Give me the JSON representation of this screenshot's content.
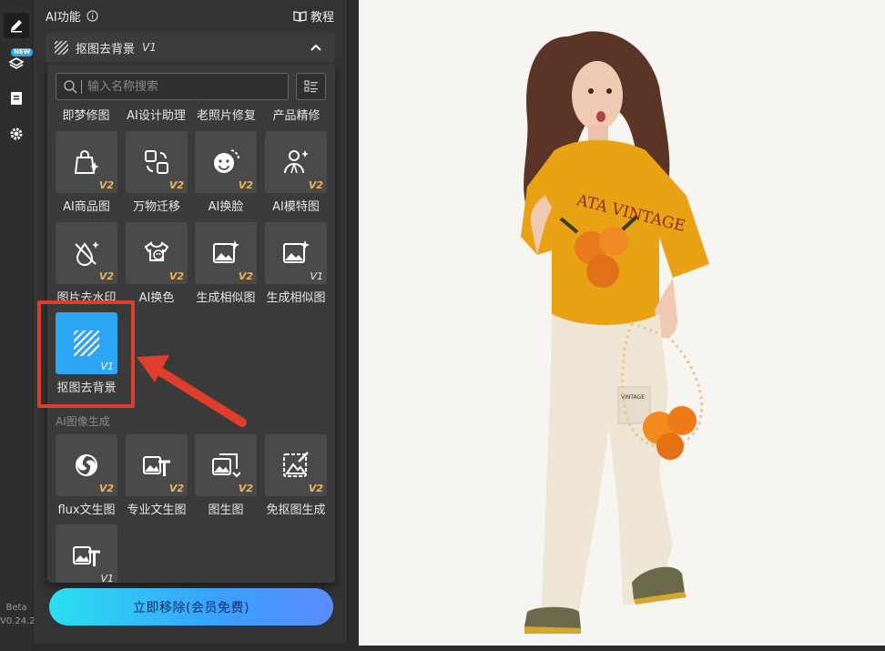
{
  "panel": {
    "title": "AI功能",
    "tutorial_label": "教程",
    "selected_feature": "抠图去背景",
    "selected_feature_version": "V1"
  },
  "rail": {
    "new_badge": "NEW",
    "beta_label": "Beta",
    "version": "V0.24.2"
  },
  "search": {
    "placeholder": "输入名称搜索"
  },
  "top_labels": [
    "即梦修图",
    "AI设计助理",
    "老照片修复",
    "产品精修"
  ],
  "tools_row1": [
    {
      "label": "AI商品图",
      "version": "V2",
      "icon": "shopping-bag-sparkle-icon"
    },
    {
      "label": "万物迁移",
      "version": "V2",
      "icon": "transfer-icon"
    },
    {
      "label": "AI换脸",
      "version": "V2",
      "icon": "face-swap-icon"
    },
    {
      "label": "AI模特图",
      "version": "V2",
      "icon": "model-person-icon"
    }
  ],
  "tools_row2": [
    {
      "label": "图片去水印",
      "version": "V2",
      "icon": "watermark-remove-icon"
    },
    {
      "label": "AI换色",
      "version": "V2",
      "icon": "tshirt-palette-icon"
    },
    {
      "label": "生成相似图",
      "version": "V2",
      "icon": "image-sparkle-icon"
    },
    {
      "label": "生成相似图",
      "version": "V1",
      "icon": "image-sparkle-icon"
    }
  ],
  "tools_row3": [
    {
      "label": "抠图去背景",
      "version": "V1",
      "icon": "cutout-stripes-icon"
    }
  ],
  "section_image_gen": "AI图像生成",
  "tools_row4": [
    {
      "label": "flux文生图",
      "version": "V2",
      "icon": "flux-swirl-icon"
    },
    {
      "label": "专业文生图",
      "version": "V2",
      "icon": "image-text-icon"
    },
    {
      "label": "图生图",
      "version": "V2",
      "icon": "image-to-image-icon"
    },
    {
      "label": "免抠图生成",
      "version": "V2",
      "icon": "cutout-free-icon"
    }
  ],
  "tools_row5": [
    {
      "label": "",
      "version": "V1",
      "icon": "image-text-icon"
    }
  ],
  "cta_label": "立即移除(会员免费)",
  "colors": {
    "accent": "#2ca6f5",
    "highlight": "#e03e2d",
    "badge_v2": "#e8b55a"
  }
}
